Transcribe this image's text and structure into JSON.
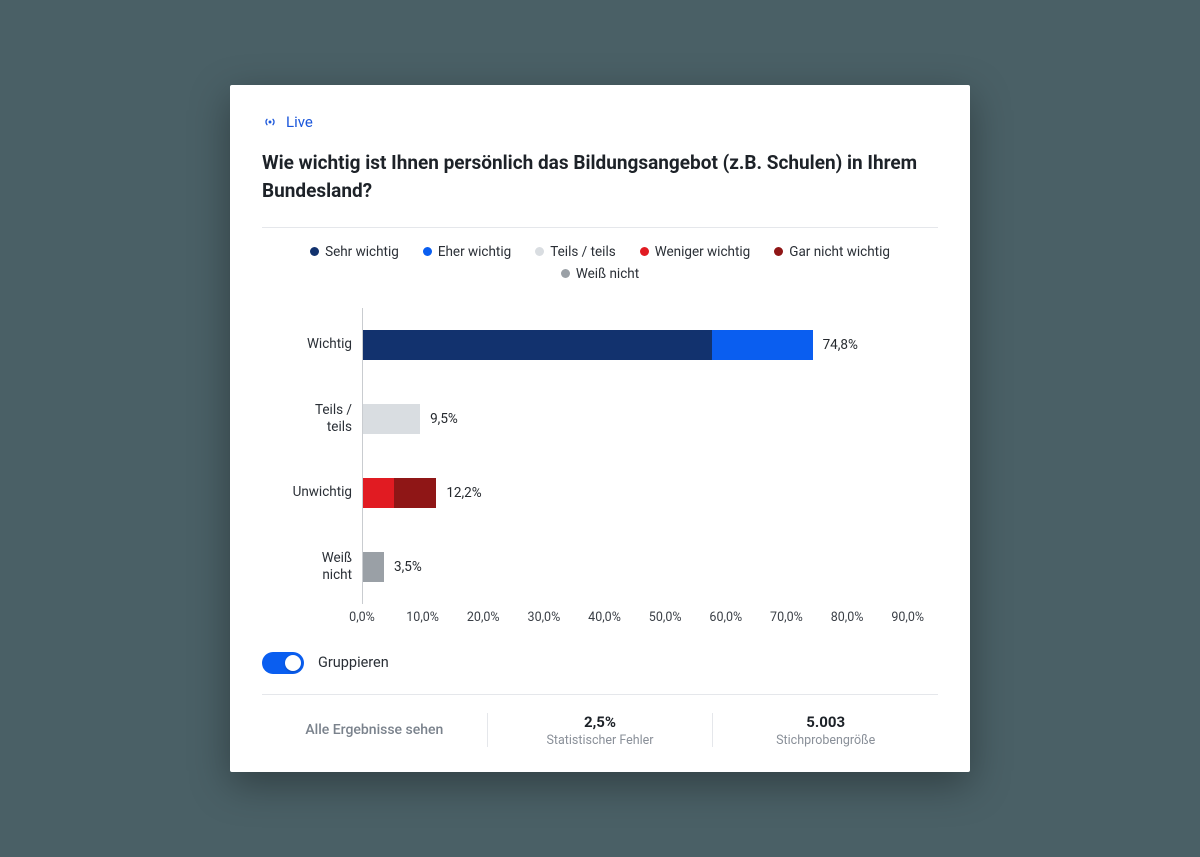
{
  "live_label": "Live",
  "question": "Wie wichtig ist Ihnen persönlich das Bildungsangebot (z.B. Schulen) in Ihrem Bundesland?",
  "legend": [
    {
      "label": "Sehr wichtig",
      "color": "#12326e"
    },
    {
      "label": "Eher wichtig",
      "color": "#0a5ef0"
    },
    {
      "label": "Teils / teils",
      "color": "#d9dde1"
    },
    {
      "label": "Weniger wichtig",
      "color": "#e11b22"
    },
    {
      "label": "Gar nicht wichtig",
      "color": "#8f1616"
    },
    {
      "label": "Weiß nicht",
      "color": "#9aa0a6"
    }
  ],
  "group_toggle": {
    "label": "Gruppieren",
    "on": true
  },
  "footer": {
    "link_text": "Alle Ergebnisse sehen",
    "error_value": "2,5%",
    "error_label": "Statistischer Fehler",
    "sample_value": "5.003",
    "sample_label": "Stichprobengröße"
  },
  "chart_data": {
    "type": "bar",
    "orientation": "horizontal",
    "stacked": true,
    "xlabel": "",
    "ylabel": "",
    "xlim": [
      0,
      95
    ],
    "x_ticks": [
      "0,0%",
      "10,0%",
      "20,0%",
      "30,0%",
      "40,0%",
      "50,0%",
      "60,0%",
      "70,0%",
      "80,0%",
      "90,0%"
    ],
    "categories": [
      "Wichtig",
      "Teils /\nteils",
      "Unwichtig",
      "Weiß\nnicht"
    ],
    "totals_labels": [
      "74,8%",
      "9,5%",
      "12,2%",
      "3,5%"
    ],
    "rows": [
      {
        "category": "Wichtig",
        "total": 74.8,
        "segments": [
          {
            "series": "Sehr wichtig",
            "value": 58.0,
            "color": "#12326e"
          },
          {
            "series": "Eher wichtig",
            "value": 16.8,
            "color": "#0a5ef0"
          }
        ]
      },
      {
        "category": "Teils / teils",
        "total": 9.5,
        "segments": [
          {
            "series": "Teils / teils",
            "value": 9.5,
            "color": "#d9dde1"
          }
        ]
      },
      {
        "category": "Unwichtig",
        "total": 12.2,
        "segments": [
          {
            "series": "Weniger wichtig",
            "value": 5.2,
            "color": "#e11b22"
          },
          {
            "series": "Gar nicht wichtig",
            "value": 7.0,
            "color": "#8f1616"
          }
        ]
      },
      {
        "category": "Weiß nicht",
        "total": 3.5,
        "segments": [
          {
            "series": "Weiß nicht",
            "value": 3.5,
            "color": "#9aa0a6"
          }
        ]
      }
    ]
  }
}
